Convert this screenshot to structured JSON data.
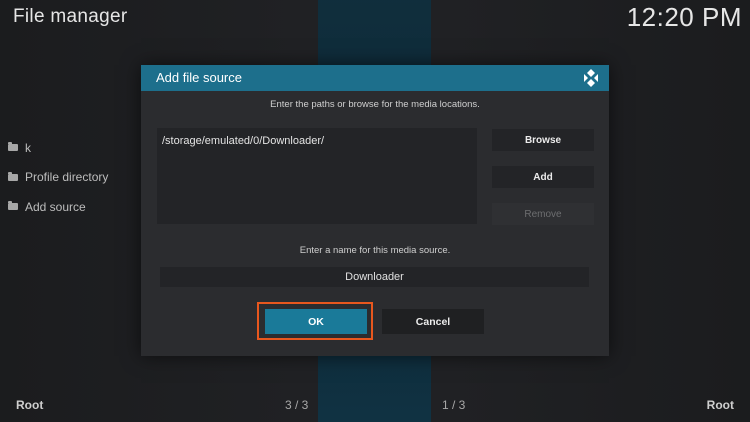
{
  "app": {
    "title": "File manager",
    "clock": "12:20 PM"
  },
  "sidebar": {
    "items": [
      {
        "label": "k",
        "icon": "folder-icon"
      },
      {
        "label": "Profile directory",
        "icon": "folder-icon"
      },
      {
        "label": "Add source",
        "icon": "folder-icon"
      }
    ]
  },
  "footer": {
    "left_label": "Root",
    "left_count": "3 / 3",
    "right_count": "1 / 3",
    "right_label": "Root"
  },
  "dialog": {
    "title": "Add file source",
    "logo_icon": "kodi-logo-icon",
    "header_color": "#1d6f8c",
    "paths_hint": "Enter the paths or browse for the media locations.",
    "paths": [
      "/storage/emulated/0/Downloader/"
    ],
    "buttons": {
      "browse": "Browse",
      "add": "Add",
      "remove": "Remove"
    },
    "name_hint": "Enter a name for this media source.",
    "name_value": "Downloader",
    "ok": "OK",
    "cancel": "Cancel",
    "highlight_color": "#e8571e",
    "accent_color": "#1a7a99"
  }
}
